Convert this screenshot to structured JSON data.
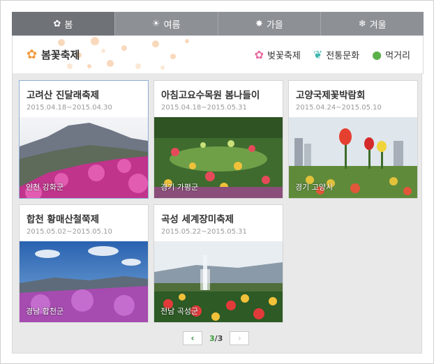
{
  "tabs": [
    {
      "label": "봄",
      "icon": "cherry-blossom-icon",
      "glyph": "✿",
      "active": true
    },
    {
      "label": "여름",
      "icon": "sun-icon",
      "glyph": "☀",
      "active": false
    },
    {
      "label": "가을",
      "icon": "maple-leaf-icon",
      "glyph": "✸",
      "active": false
    },
    {
      "label": "겨울",
      "icon": "snowflake-icon",
      "glyph": "❄",
      "active": false
    }
  ],
  "banner": {
    "title": "봄꽃축제",
    "icon": "flower-icon",
    "subnav": [
      {
        "label": "벚꽃축제",
        "icon": "cherry-blossom-icon",
        "color": "#e86aa0"
      },
      {
        "label": "전통문화",
        "icon": "wave-icon",
        "color": "#3fb7b0"
      },
      {
        "label": "먹거리",
        "icon": "strawberry-icon",
        "color": "#5bb04a"
      }
    ]
  },
  "cards": [
    {
      "title": "고려산 진달래축제",
      "date": "2015.04.18~2015.04.30",
      "location": "인천 강화군"
    },
    {
      "title": "아침고요수목원 봄나들이",
      "date": "2015.04.18~2015.05.31",
      "location": "경기 가평군"
    },
    {
      "title": "고양국제꽃박람회",
      "date": "2015.04.24~2015.05.10",
      "location": "경기 고양시"
    },
    {
      "title": "합천 황매산철쭉제",
      "date": "2015.05.02~2015.05.10",
      "location": "경남 합천군"
    },
    {
      "title": "곡성 세계장미축제",
      "date": "2015.05.22~2015.05.31",
      "location": "전남 곡성군"
    }
  ],
  "pagination": {
    "current": "3",
    "separator": "/",
    "total": "3",
    "prev_glyph": "‹",
    "next_glyph": "›"
  },
  "colors": {
    "tab_bg": "#8d9196",
    "tab_active": "#6f7277",
    "pager_current": "#3c9a38"
  }
}
